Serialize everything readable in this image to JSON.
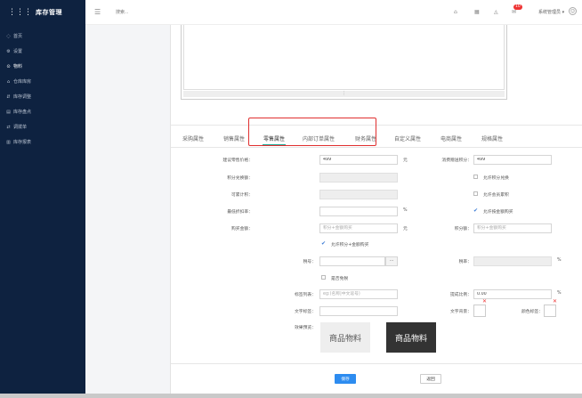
{
  "app": {
    "title": "库存管理",
    "logo_icon": "grid-icon"
  },
  "sidebar": {
    "items": [
      {
        "label": "首页",
        "icon": "home-icon"
      },
      {
        "label": "设置",
        "icon": "gear-icon"
      },
      {
        "label": "物料",
        "icon": "box-icon",
        "active": true
      },
      {
        "label": "仓库库房",
        "icon": "warehouse-icon"
      },
      {
        "label": "库存调整",
        "icon": "adjust-icon"
      },
      {
        "label": "库存盘点",
        "icon": "clipboard-icon"
      },
      {
        "label": "调拨单",
        "icon": "transfer-icon"
      },
      {
        "label": "库存报表",
        "icon": "chart-icon"
      }
    ]
  },
  "topbar": {
    "search_placeholder": "搜索...",
    "notification_count": "10",
    "user_name": "系统管理员 ▾"
  },
  "tabs": [
    {
      "label": "采购属性"
    },
    {
      "label": "销售属性"
    },
    {
      "label": "零售属性",
      "active": true
    },
    {
      "label": "内部订单属性"
    },
    {
      "label": "财务属性"
    },
    {
      "label": "自定义属性"
    },
    {
      "label": "电商属性"
    },
    {
      "label": "规格属性"
    }
  ],
  "form": {
    "retail_price_label": "建议零售价格：",
    "retail_price_value": "499",
    "retail_price_unit": "元",
    "points_label": "消费赠送积分：",
    "points_value": "499",
    "points_exchange_label": "积分兑换额：",
    "allow_points_exchange_label": "允许积分兑换",
    "accumulate_label": "可累计积：",
    "allow_member_label": "允许会员累积",
    "min_discount_label": "最低折扣率：",
    "min_discount_unit": "%",
    "allow_discount_label": "允许按金额购买",
    "buy_amount_label": "购买金额：",
    "buy_amount_placeholder": "积分+金额购买",
    "buy_amount_unit": "元",
    "points_amount_label": "积分额：",
    "points_amount_placeholder": "积分+金额购买",
    "allow_points_amount_label": "允许积分+金额购买",
    "tax_code_label": "税号：",
    "tax_code_button": "···",
    "tax_rate_label": "税率：",
    "tax_rate_unit": "%",
    "tax_exempt_label": "是否免税",
    "tag_list_label": "标签列表：",
    "tag_list_placeholder": "eg:(名称|中文逗号)",
    "commission_label": "提成比例：",
    "commission_value": "0.00",
    "commission_unit": "%",
    "text_tag_label": "文字标签：",
    "text_bg_label": "文字背景：",
    "color_tag_label": "颜色标签：",
    "preview_label": "效果预览：",
    "preview_light": "商品物料",
    "preview_dark": "商品物料"
  },
  "buttons": {
    "save": "保存",
    "back": "返回"
  },
  "colors": {
    "sidebar_bg": "#0e2240",
    "primary": "#2d8cf0",
    "highlight": "#e03030",
    "tab_underline": "#22aa99"
  }
}
